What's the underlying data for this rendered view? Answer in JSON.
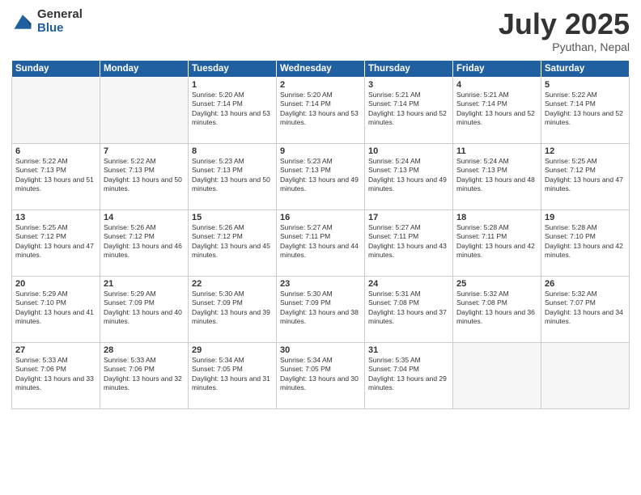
{
  "header": {
    "logo_general": "General",
    "logo_blue": "Blue",
    "month_title": "July 2025",
    "location": "Pyuthan, Nepal"
  },
  "weekdays": [
    "Sunday",
    "Monday",
    "Tuesday",
    "Wednesday",
    "Thursday",
    "Friday",
    "Saturday"
  ],
  "weeks": [
    [
      {
        "day": "",
        "empty": true
      },
      {
        "day": "",
        "empty": true
      },
      {
        "day": "1",
        "sunrise": "5:20 AM",
        "sunset": "7:14 PM",
        "daylight": "13 hours and 53 minutes."
      },
      {
        "day": "2",
        "sunrise": "5:20 AM",
        "sunset": "7:14 PM",
        "daylight": "13 hours and 53 minutes."
      },
      {
        "day": "3",
        "sunrise": "5:21 AM",
        "sunset": "7:14 PM",
        "daylight": "13 hours and 52 minutes."
      },
      {
        "day": "4",
        "sunrise": "5:21 AM",
        "sunset": "7:14 PM",
        "daylight": "13 hours and 52 minutes."
      },
      {
        "day": "5",
        "sunrise": "5:22 AM",
        "sunset": "7:14 PM",
        "daylight": "13 hours and 52 minutes."
      }
    ],
    [
      {
        "day": "6",
        "sunrise": "5:22 AM",
        "sunset": "7:13 PM",
        "daylight": "13 hours and 51 minutes."
      },
      {
        "day": "7",
        "sunrise": "5:22 AM",
        "sunset": "7:13 PM",
        "daylight": "13 hours and 50 minutes."
      },
      {
        "day": "8",
        "sunrise": "5:23 AM",
        "sunset": "7:13 PM",
        "daylight": "13 hours and 50 minutes."
      },
      {
        "day": "9",
        "sunrise": "5:23 AM",
        "sunset": "7:13 PM",
        "daylight": "13 hours and 49 minutes."
      },
      {
        "day": "10",
        "sunrise": "5:24 AM",
        "sunset": "7:13 PM",
        "daylight": "13 hours and 49 minutes."
      },
      {
        "day": "11",
        "sunrise": "5:24 AM",
        "sunset": "7:13 PM",
        "daylight": "13 hours and 48 minutes."
      },
      {
        "day": "12",
        "sunrise": "5:25 AM",
        "sunset": "7:12 PM",
        "daylight": "13 hours and 47 minutes."
      }
    ],
    [
      {
        "day": "13",
        "sunrise": "5:25 AM",
        "sunset": "7:12 PM",
        "daylight": "13 hours and 47 minutes."
      },
      {
        "day": "14",
        "sunrise": "5:26 AM",
        "sunset": "7:12 PM",
        "daylight": "13 hours and 46 minutes."
      },
      {
        "day": "15",
        "sunrise": "5:26 AM",
        "sunset": "7:12 PM",
        "daylight": "13 hours and 45 minutes."
      },
      {
        "day": "16",
        "sunrise": "5:27 AM",
        "sunset": "7:11 PM",
        "daylight": "13 hours and 44 minutes."
      },
      {
        "day": "17",
        "sunrise": "5:27 AM",
        "sunset": "7:11 PM",
        "daylight": "13 hours and 43 minutes."
      },
      {
        "day": "18",
        "sunrise": "5:28 AM",
        "sunset": "7:11 PM",
        "daylight": "13 hours and 42 minutes."
      },
      {
        "day": "19",
        "sunrise": "5:28 AM",
        "sunset": "7:10 PM",
        "daylight": "13 hours and 42 minutes."
      }
    ],
    [
      {
        "day": "20",
        "sunrise": "5:29 AM",
        "sunset": "7:10 PM",
        "daylight": "13 hours and 41 minutes."
      },
      {
        "day": "21",
        "sunrise": "5:29 AM",
        "sunset": "7:09 PM",
        "daylight": "13 hours and 40 minutes."
      },
      {
        "day": "22",
        "sunrise": "5:30 AM",
        "sunset": "7:09 PM",
        "daylight": "13 hours and 39 minutes."
      },
      {
        "day": "23",
        "sunrise": "5:30 AM",
        "sunset": "7:09 PM",
        "daylight": "13 hours and 38 minutes."
      },
      {
        "day": "24",
        "sunrise": "5:31 AM",
        "sunset": "7:08 PM",
        "daylight": "13 hours and 37 minutes."
      },
      {
        "day": "25",
        "sunrise": "5:32 AM",
        "sunset": "7:08 PM",
        "daylight": "13 hours and 36 minutes."
      },
      {
        "day": "26",
        "sunrise": "5:32 AM",
        "sunset": "7:07 PM",
        "daylight": "13 hours and 34 minutes."
      }
    ],
    [
      {
        "day": "27",
        "sunrise": "5:33 AM",
        "sunset": "7:06 PM",
        "daylight": "13 hours and 33 minutes."
      },
      {
        "day": "28",
        "sunrise": "5:33 AM",
        "sunset": "7:06 PM",
        "daylight": "13 hours and 32 minutes."
      },
      {
        "day": "29",
        "sunrise": "5:34 AM",
        "sunset": "7:05 PM",
        "daylight": "13 hours and 31 minutes."
      },
      {
        "day": "30",
        "sunrise": "5:34 AM",
        "sunset": "7:05 PM",
        "daylight": "13 hours and 30 minutes."
      },
      {
        "day": "31",
        "sunrise": "5:35 AM",
        "sunset": "7:04 PM",
        "daylight": "13 hours and 29 minutes."
      },
      {
        "day": "",
        "empty": true
      },
      {
        "day": "",
        "empty": true
      }
    ]
  ]
}
